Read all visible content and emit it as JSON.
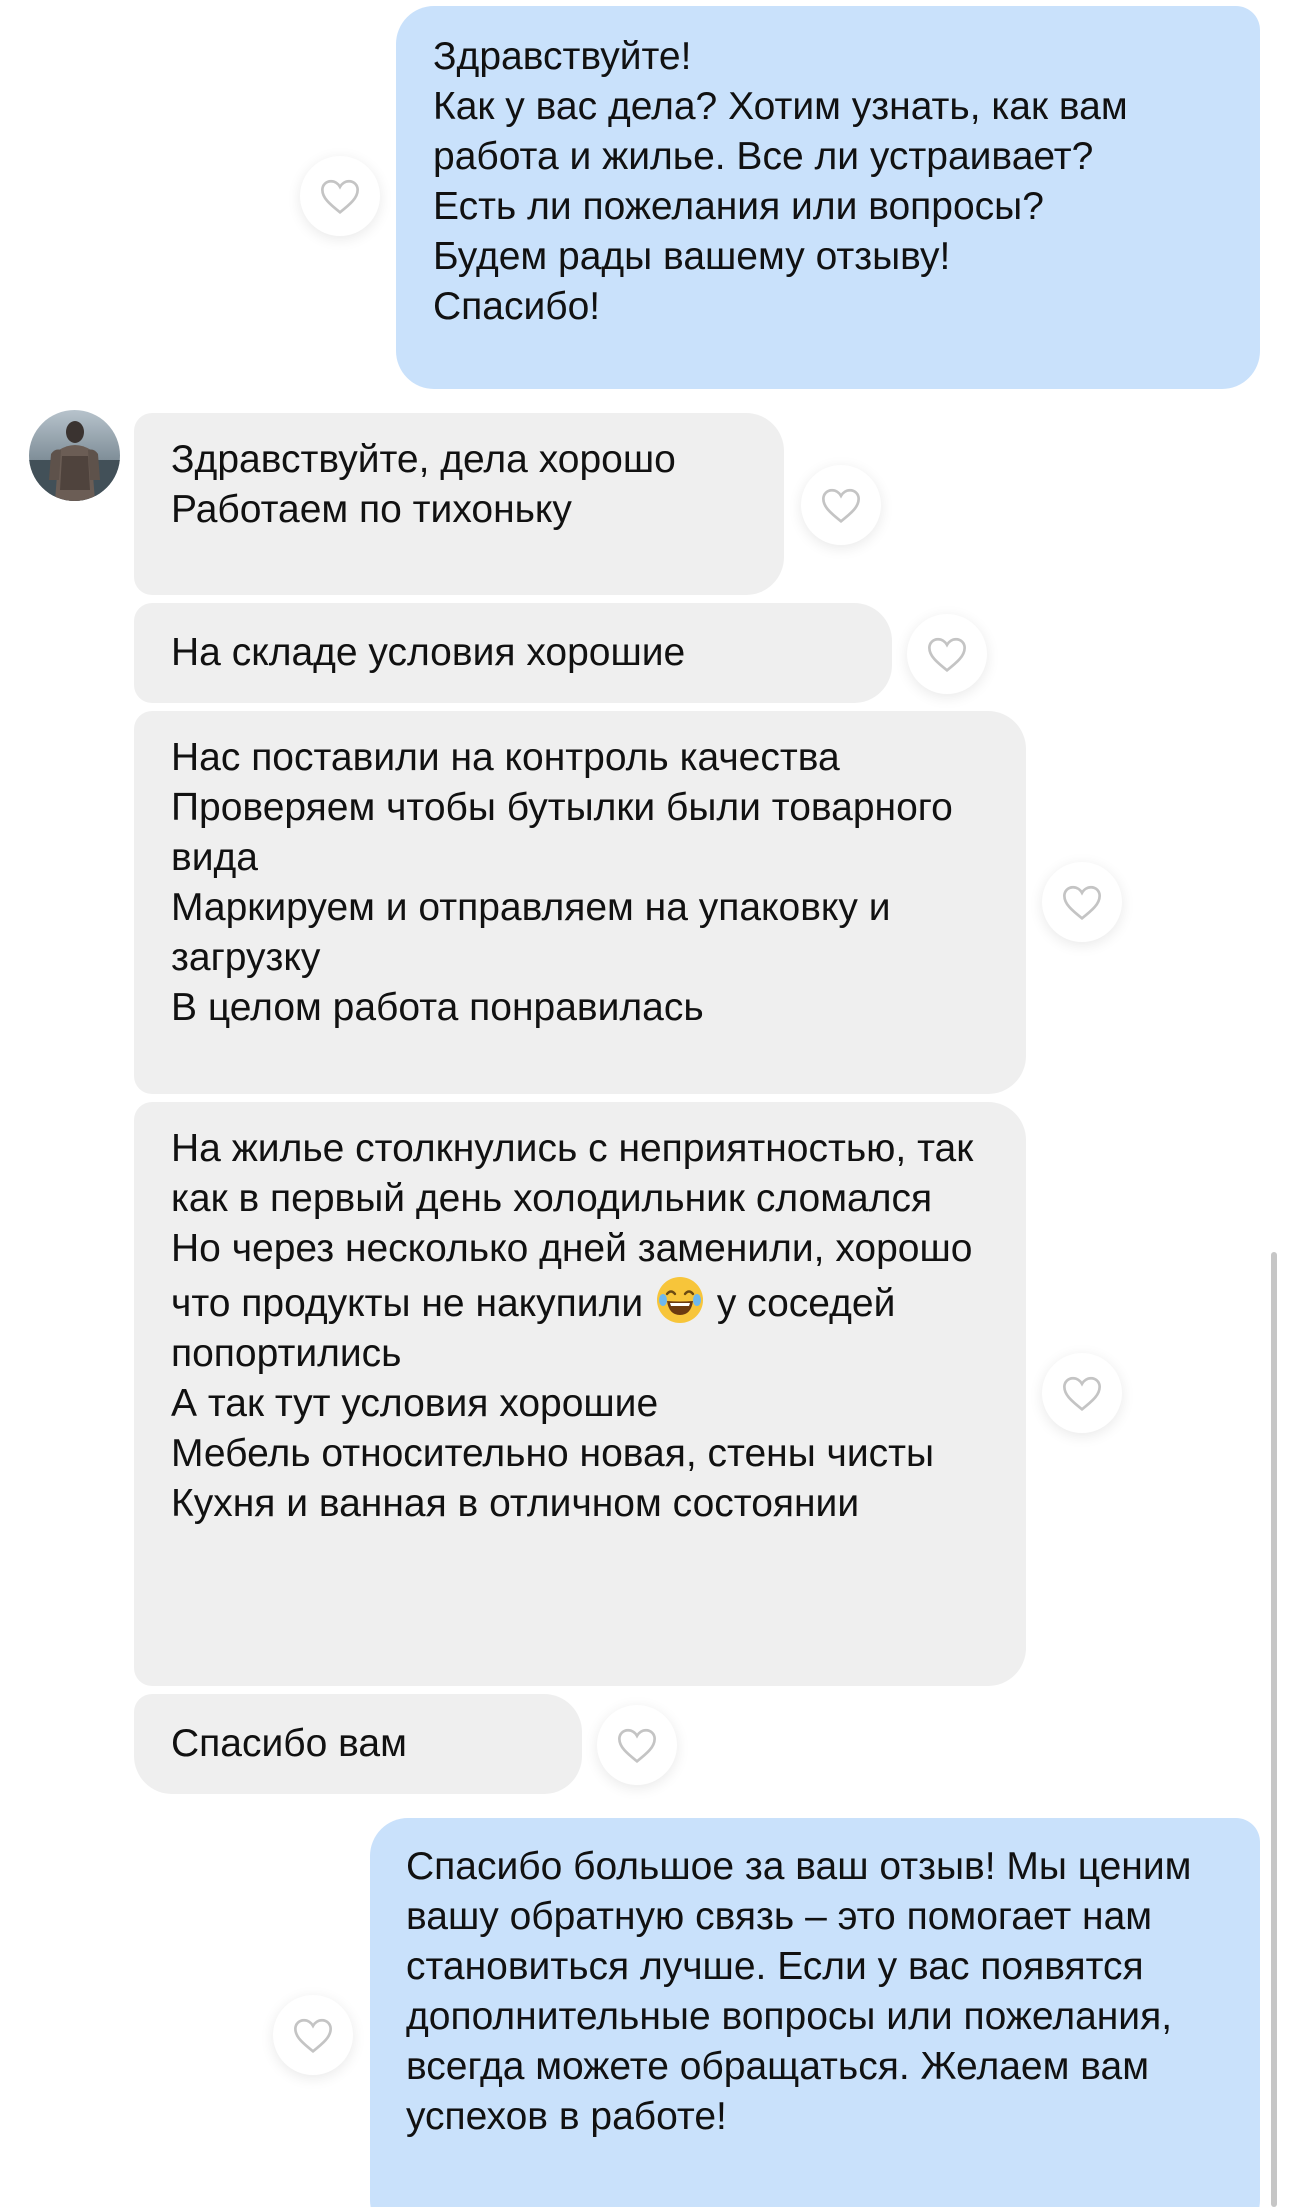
{
  "messages": [
    {
      "direction": "outgoing",
      "text": "Здравствуйте!\nКак у вас дела? Хотим узнать, как вам работа и жилье. Все ли устраивает?\nЕсть ли пожелания или вопросы?\nБудем рады вашему отзыву!\nСпасибо!"
    },
    {
      "direction": "incoming",
      "text": "Здравствуйте, дела хорошо\nРаботаем по тихоньку"
    },
    {
      "direction": "incoming",
      "text": "На складе условия хорошие"
    },
    {
      "direction": "incoming",
      "text": "Нас поставили на контроль качества\nПроверяем чтобы бутылки были товарного вида\nМаркируем и отправляем на упаковку и загрузку\nВ целом работа понравилась"
    },
    {
      "direction": "incoming",
      "text_before_emoji": "На жилье столкнулись с неприятностью, так как в первый день холодильник сломался\nНо через несколько дней заменили, хорошо что продукты не накупили",
      "emoji": "face-with-tears-of-joy",
      "text_after_emoji": "у соседей попортились\nА так тут условия хорошие\nМебель относительно новая, стены чисты\nКухня и ванная в отличном состоянии"
    },
    {
      "direction": "incoming",
      "text": "Спасибо вам"
    },
    {
      "direction": "outgoing",
      "text": "Спасибо большое за ваш отзыв! Мы ценим вашу обратную связь – это помогает нам становиться лучше. Если у вас появятся дополнительные вопросы или пожелания, всегда можете обращаться. Желаем вам успехов в работе!"
    }
  ],
  "icons": {
    "like": "heart-outline-icon",
    "avatar": "contact-avatar"
  },
  "colors": {
    "outgoing_bubble": "#c9e1fb",
    "incoming_bubble": "#efefef",
    "text": "#111111",
    "heart_outline": "#c4c4c4"
  }
}
